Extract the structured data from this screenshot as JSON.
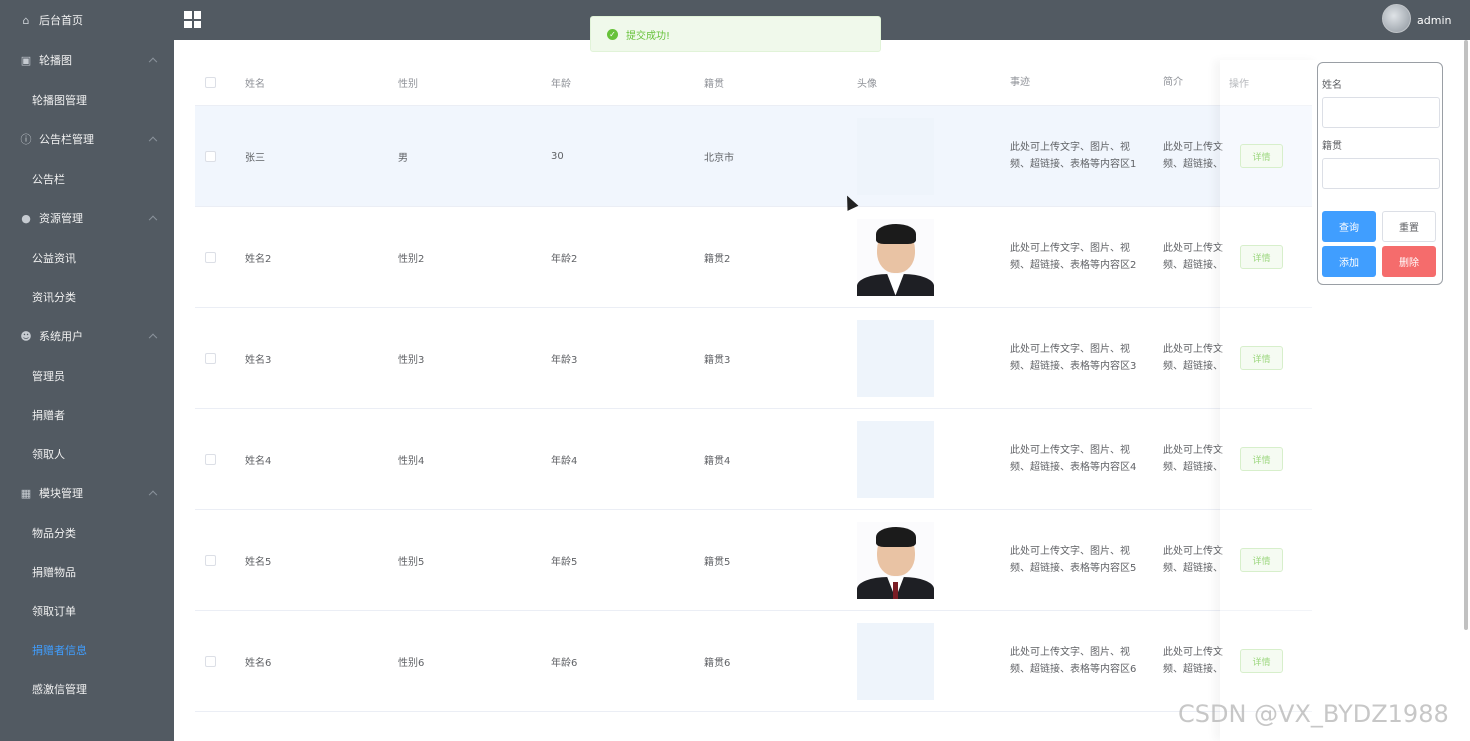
{
  "sidebar": {
    "items": [
      {
        "label": "后台首页",
        "icon": "home-icon",
        "type": "top"
      },
      {
        "label": "轮播图",
        "icon": "image-icon",
        "type": "group"
      },
      {
        "label": "轮播图管理",
        "type": "sub"
      },
      {
        "label": "公告栏管理",
        "icon": "info-icon",
        "type": "group"
      },
      {
        "label": "公告栏",
        "type": "sub"
      },
      {
        "label": "资源管理",
        "icon": "location-icon",
        "type": "group"
      },
      {
        "label": "公益资讯",
        "type": "sub"
      },
      {
        "label": "资讯分类",
        "type": "sub"
      },
      {
        "label": "系统用户",
        "icon": "user-icon",
        "type": "group"
      },
      {
        "label": "管理员",
        "type": "sub"
      },
      {
        "label": "捐赠者",
        "type": "sub"
      },
      {
        "label": "领取人",
        "type": "sub"
      },
      {
        "label": "模块管理",
        "icon": "grid-icon",
        "type": "group"
      },
      {
        "label": "物品分类",
        "type": "sub"
      },
      {
        "label": "捐赠物品",
        "type": "sub"
      },
      {
        "label": "领取订单",
        "type": "sub"
      },
      {
        "label": "捐赠者信息",
        "type": "sub",
        "active": true
      },
      {
        "label": "感激信管理",
        "type": "sub"
      }
    ]
  },
  "header": {
    "user": "admin"
  },
  "toast": {
    "message": "提交成功!"
  },
  "table": {
    "headers": [
      "姓名",
      "性别",
      "年龄",
      "籍贯",
      "头像",
      "事迹",
      "简介",
      "操作"
    ],
    "rows": [
      {
        "name": "张三",
        "gender": "男",
        "age": "30",
        "origin": "北京市",
        "photo": "blank",
        "deed1": "此处可上传文字、图片、视",
        "deed2": "频、超链接、表格等内容区1",
        "intro1": "此处可上传文",
        "intro2": "频、超链接、",
        "op": "详情"
      },
      {
        "name": "姓名2",
        "gender": "性别2",
        "age": "年龄2",
        "origin": "籍贯2",
        "photo": "person",
        "deed1": "此处可上传文字、图片、视",
        "deed2": "频、超链接、表格等内容区2",
        "intro1": "此处可上传文",
        "intro2": "频、超链接、",
        "op": "详情"
      },
      {
        "name": "姓名3",
        "gender": "性别3",
        "age": "年龄3",
        "origin": "籍贯3",
        "photo": "blank",
        "deed1": "此处可上传文字、图片、视",
        "deed2": "频、超链接、表格等内容区3",
        "intro1": "此处可上传文",
        "intro2": "频、超链接、",
        "op": "详情"
      },
      {
        "name": "姓名4",
        "gender": "性别4",
        "age": "年龄4",
        "origin": "籍贯4",
        "photo": "blank",
        "deed1": "此处可上传文字、图片、视",
        "deed2": "频、超链接、表格等内容区4",
        "intro1": "此处可上传文",
        "intro2": "频、超链接、",
        "op": "详情"
      },
      {
        "name": "姓名5",
        "gender": "性别5",
        "age": "年龄5",
        "origin": "籍贯5",
        "photo": "person-tie",
        "deed1": "此处可上传文字、图片、视",
        "deed2": "频、超链接、表格等内容区5",
        "intro1": "此处可上传文",
        "intro2": "频、超链接、",
        "op": "详情"
      },
      {
        "name": "姓名6",
        "gender": "性别6",
        "age": "年龄6",
        "origin": "籍贯6",
        "photo": "blank",
        "deed1": "此处可上传文字、图片、视",
        "deed2": "频、超链接、表格等内容区6",
        "intro1": "此处可上传文",
        "intro2": "频、超链接、",
        "op": "详情"
      }
    ]
  },
  "search": {
    "name_label": "姓名",
    "origin_label": "籍贯",
    "query": "查询",
    "reset": "重置",
    "add": "添加",
    "delete": "删除"
  },
  "watermark": "CSDN @VX_BYDZ1988"
}
